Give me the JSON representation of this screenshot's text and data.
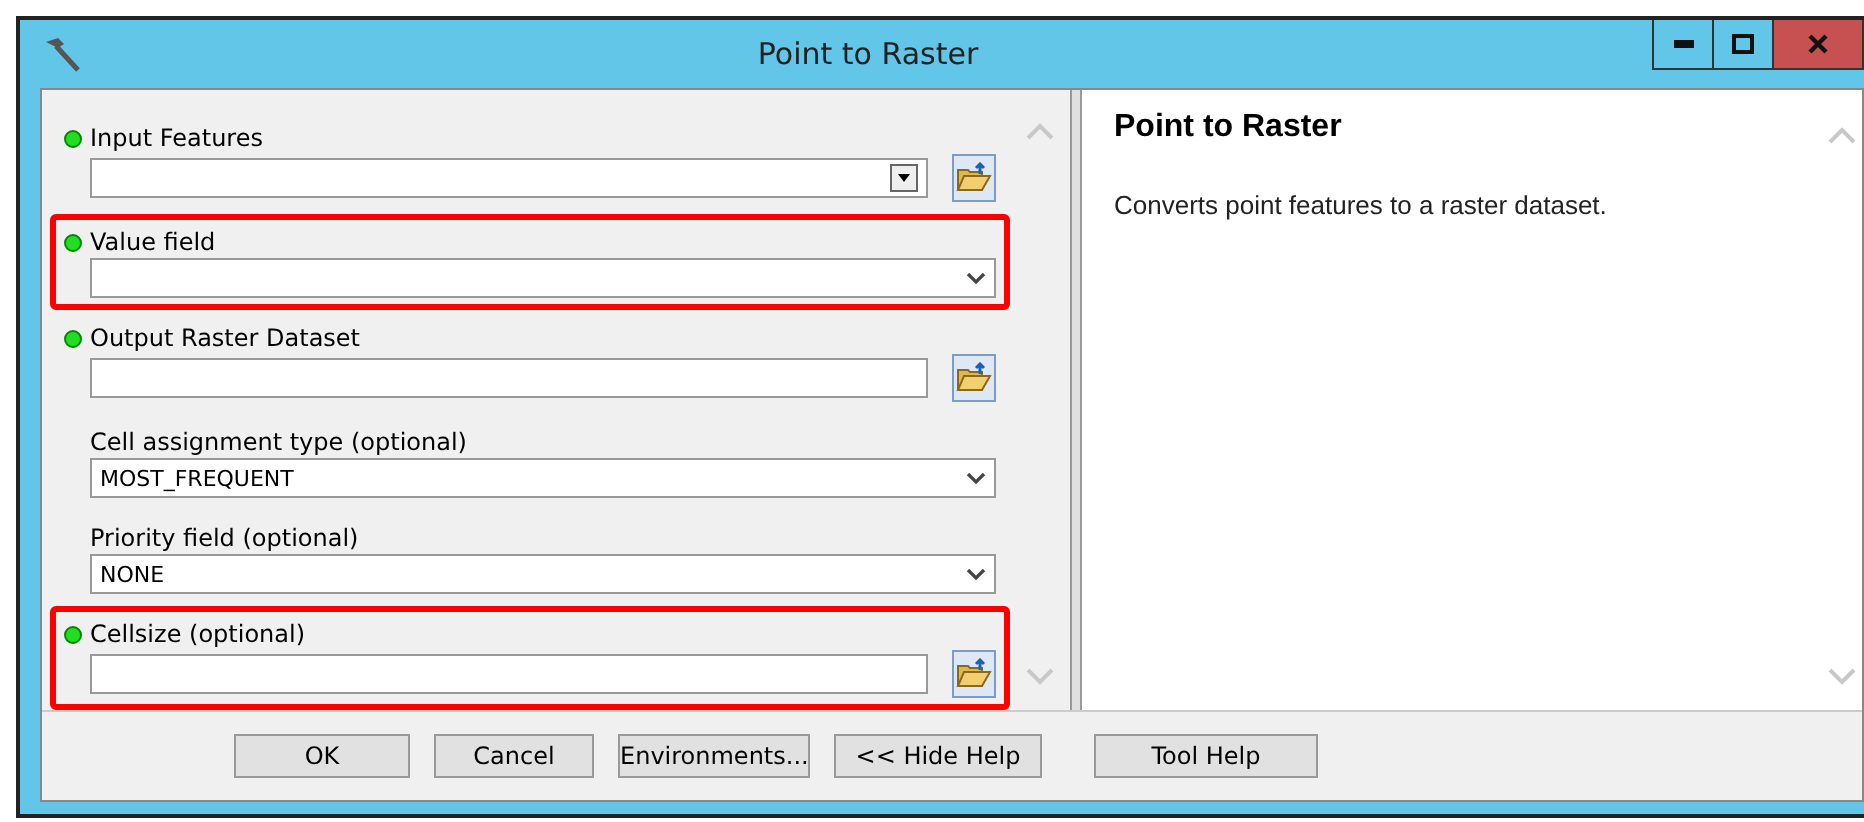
{
  "window": {
    "title": "Point to Raster"
  },
  "fields": [
    {
      "label": "Input Features",
      "kind": "combo-browse",
      "required": true,
      "highlighted": false
    },
    {
      "label": "Value field",
      "kind": "select",
      "required": true,
      "highlighted": true
    },
    {
      "label": "Output Raster Dataset",
      "kind": "text-browse",
      "required": true,
      "highlighted": false
    },
    {
      "label": "Cell assignment type (optional)",
      "kind": "select",
      "value": "MOST_FREQUENT",
      "required": false,
      "highlighted": false
    },
    {
      "label": "Priority field (optional)",
      "kind": "select",
      "value": "NONE",
      "required": false,
      "highlighted": false
    },
    {
      "label": "Cellsize (optional)",
      "kind": "text-browse",
      "required": true,
      "highlighted": true
    }
  ],
  "help": {
    "title": "Point to Raster",
    "text": "Converts point features to a raster dataset."
  },
  "buttons": [
    "OK",
    "Cancel",
    "Environments...",
    "<< Hide Help",
    "Tool Help"
  ]
}
